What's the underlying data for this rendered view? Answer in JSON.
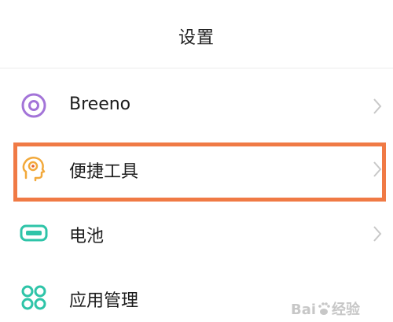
{
  "header": {
    "title": "设置"
  },
  "settings": {
    "items": [
      {
        "label": "Breeno",
        "icon": "breeno-ring-icon"
      },
      {
        "label": "便捷工具",
        "icon": "head-tool-icon"
      },
      {
        "label": "电池",
        "icon": "battery-icon"
      },
      {
        "label": "应用管理",
        "icon": "app-grid-icon"
      }
    ]
  },
  "colors": {
    "highlight": "#f07a45",
    "breeno_icon": "#a374d8",
    "tools_icon": "#f2a93b",
    "battery_icon": "#2ec4a8",
    "apps_icon": "#2ec4a8"
  },
  "watermark": {
    "logo_text": "Baidu经验"
  }
}
